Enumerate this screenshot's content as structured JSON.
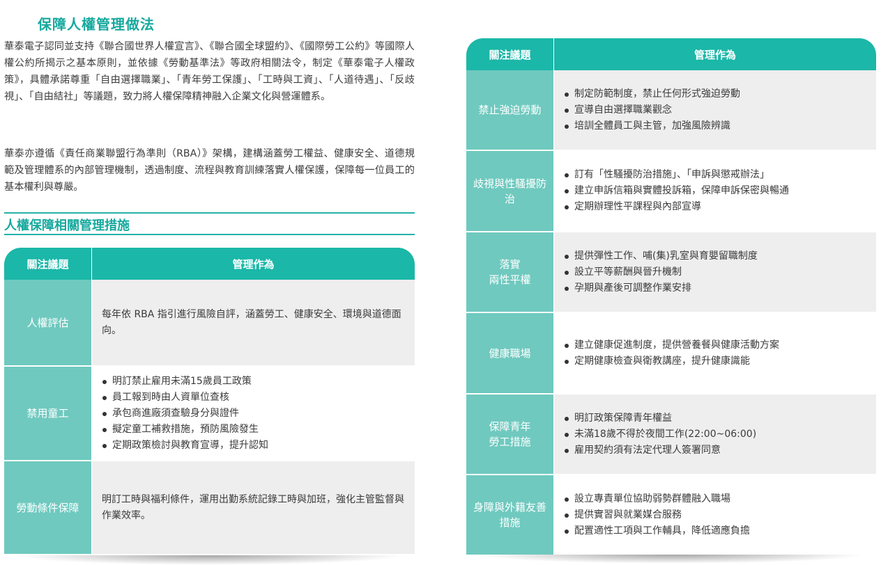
{
  "left": {
    "heading": "保障人權管理做法",
    "paragraph1": "華泰電子認同並支持《聯合國世界人權宣言》、《聯合國全球盟約》、《國際勞工公約》等國際人權公約所揭示之基本原則，並依據《勞動基準法》等政府相關法令，制定《華泰電子人權政策》，具體承諾尊重「自由選擇職業」、「青年勞工保護」、「工時與工資」、「人道待遇」、「反歧視」、「自由結社」等議題，致力將人權保障精神融入企業文化與營運體系。",
    "paragraph2": "華泰亦遵循《責任商業聯盟行為準則（RBA）》架構，建構涵蓋勞工權益、健康安全、道德規範及管理體系的內部管理機制，透過制度、流程與教育訓練落實人權保護，保障每一位員工的基本權利與尊嚴。",
    "subheading": "人權保障相關管理措施"
  },
  "table1": {
    "header_topic": "關注議題",
    "header_action": "管理作為",
    "rows": [
      {
        "topic": "人權評估",
        "text": "每年依 RBA 指引進行風險自評，涵蓋勞工、健康安全、環境與道德面向。"
      },
      {
        "topic": "禁用童工",
        "bullets": [
          "明訂禁止雇用未滿15歲員工政策",
          "員工報到時由人資單位查核",
          "承包商進廠須查驗身分與證件",
          "擬定童工補救措施，預防風險發生",
          "定期政策檢討與教育宣導，提升認知"
        ]
      },
      {
        "topic": "勞動條件保障",
        "text": "明訂工時與福利條件，運用出勤系統記錄工時與加班，強化主管監督與作業效率。"
      }
    ]
  },
  "table2": {
    "header_topic": "關注議題",
    "header_action": "管理作為",
    "rows": [
      {
        "topic": "禁止強迫勞動",
        "bullets": [
          "制定防範制度，禁止任何形式強迫勞動",
          "宣導自由選擇職業觀念",
          "培訓全體員工與主管，加強風險辨識"
        ]
      },
      {
        "topic": "歧視與性騷擾防治",
        "bullets": [
          "訂有「性騷擾防治措施」、「申訴與懲戒辦法」",
          "建立申訴信箱與實體投訴箱，保障申訴保密與暢通",
          "定期辦理性平課程與內部宣導"
        ]
      },
      {
        "topic": "落實\n兩性平權",
        "bullets": [
          "提供彈性工作、哺(集)乳室與育嬰留職制度",
          "設立平等薪酬與晉升機制",
          "孕期與產後可調整作業安排"
        ]
      },
      {
        "topic": "健康職場",
        "bullets": [
          "建立健康促進制度，提供營養餐與健康活動方案",
          "定期健康檢查與衛教講座，提升健康識能"
        ]
      },
      {
        "topic": "保障青年\n勞工措施",
        "bullets": [
          "明訂政策保障青年權益",
          "未滿18歲不得於夜間工作(22:00~06:00)",
          "雇用契約須有法定代理人簽署同意"
        ]
      },
      {
        "topic": "身障與外籍友善\n措施",
        "bullets": [
          "設立專責單位協助弱勢群體融入職場",
          "提供實習與就業媒合服務",
          "配置適性工項與工作輔具，降低適應負擔"
        ]
      }
    ]
  }
}
